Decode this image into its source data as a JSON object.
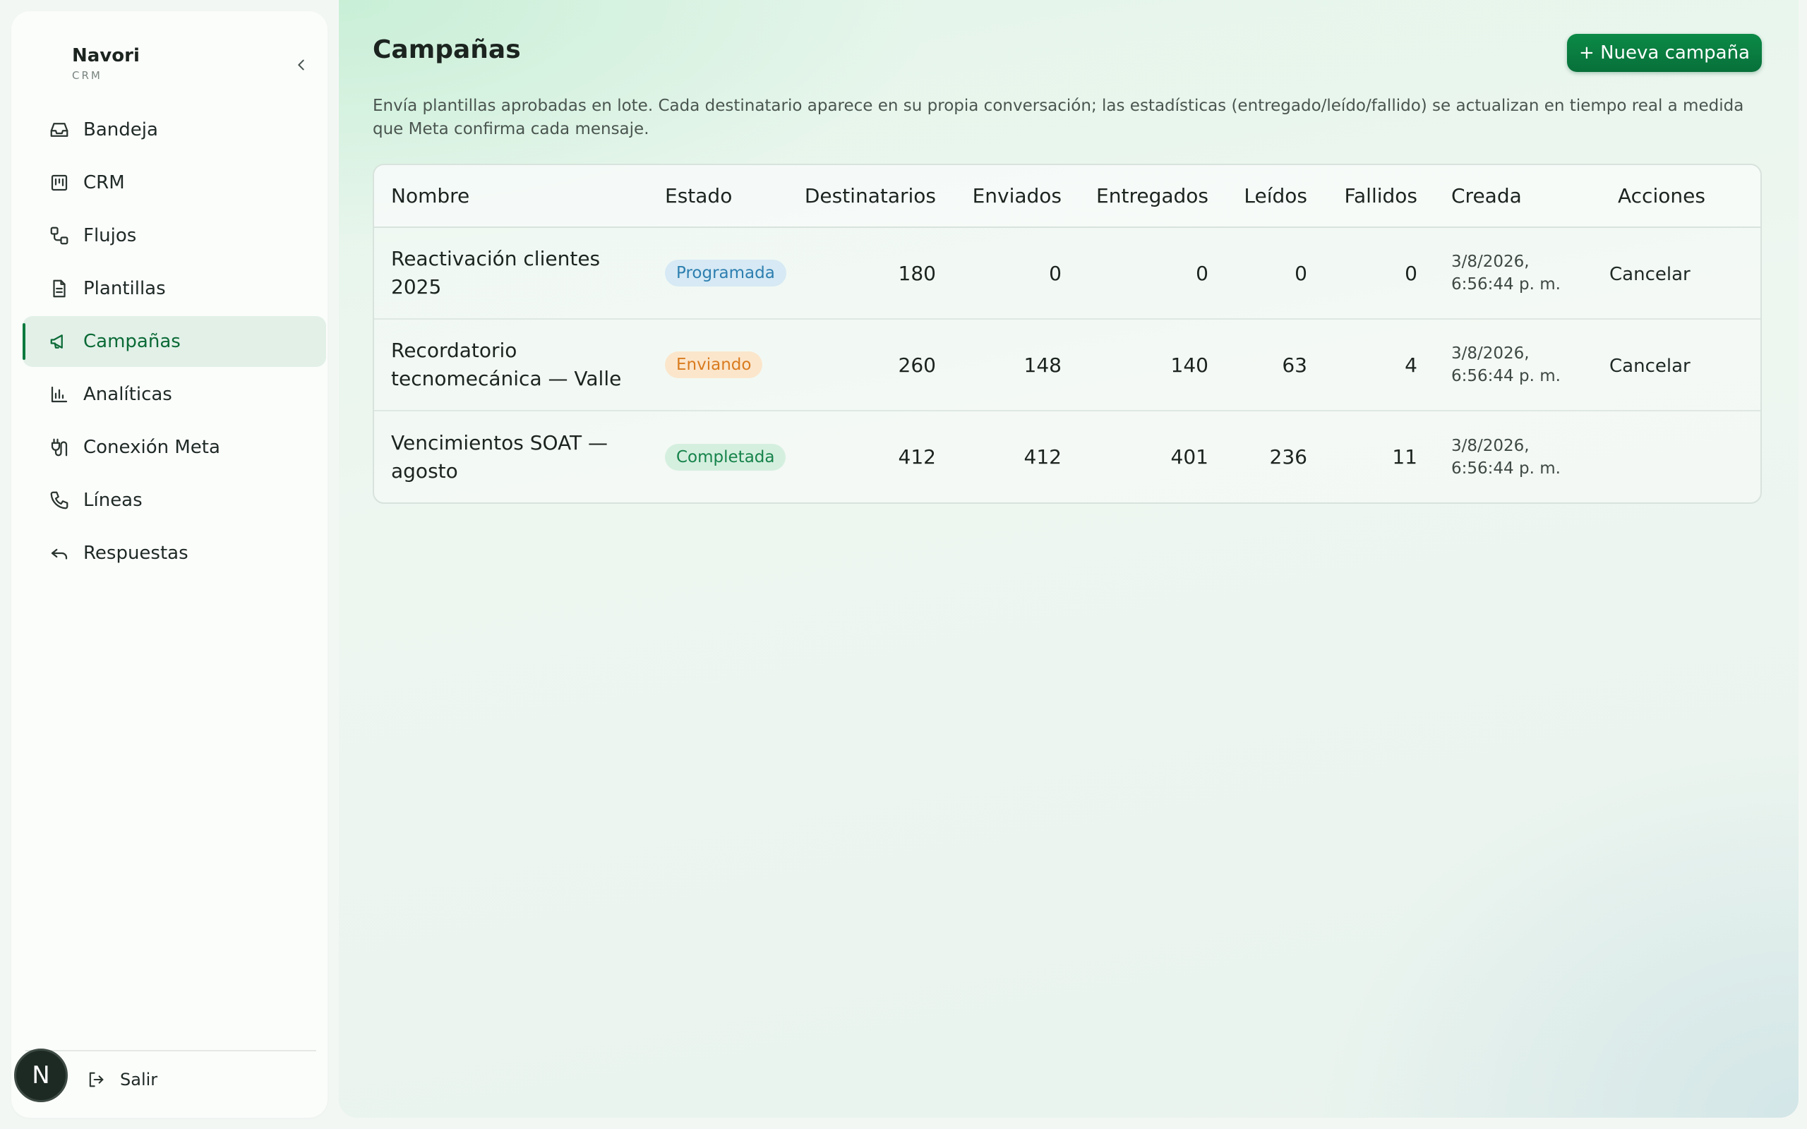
{
  "brand": {
    "name": "Navori",
    "sub": "CRM"
  },
  "sidebar": {
    "items": [
      {
        "label": "Bandeja",
        "icon": "inbox-icon"
      },
      {
        "label": "CRM",
        "icon": "kanban-icon"
      },
      {
        "label": "Flujos",
        "icon": "workflow-icon"
      },
      {
        "label": "Plantillas",
        "icon": "document-icon"
      },
      {
        "label": "Campañas",
        "icon": "megaphone-icon",
        "active": true
      },
      {
        "label": "Analíticas",
        "icon": "bar-chart-icon"
      },
      {
        "label": "Conexión Meta",
        "icon": "plug-icon"
      },
      {
        "label": "Líneas",
        "icon": "phone-icon"
      },
      {
        "label": "Respuestas",
        "icon": "reply-icon"
      }
    ],
    "avatar_letter": "N",
    "logout_label": "Salir"
  },
  "main": {
    "title": "Campañas",
    "new_button": "+ Nueva campaña",
    "description": "Envía plantillas aprobadas en lote. Cada destinatario aparece en su propia conversación; las estadísticas (entregado/leído/fallido) se actualizan en tiempo real a medida que Meta confirma cada mensaje."
  },
  "table": {
    "headers": {
      "nombre": "Nombre",
      "estado": "Estado",
      "destinatarios": "Destinatarios",
      "enviados": "Enviados",
      "entregados": "Entregados",
      "leidos": "Leídos",
      "fallidos": "Fallidos",
      "creada": "Creada",
      "acciones": "Acciones"
    },
    "rows": [
      {
        "nombre": "Reactivación clientes 2025",
        "estado": "Programada",
        "estado_color": "#2d7fb0",
        "destinatarios": "180",
        "enviados": "0",
        "entregados": "0",
        "leidos": "0",
        "fallidos": "0",
        "creada_fecha": "3/8/2026,",
        "creada_hora": "6:56:44 p. m.",
        "accion": "Cancelar"
      },
      {
        "nombre": "Recordatorio tecnomecánica — Valle",
        "estado": "Enviando",
        "estado_color": "#d97b1f",
        "destinatarios": "260",
        "enviados": "148",
        "entregados": "140",
        "leidos": "63",
        "fallidos": "4",
        "creada_fecha": "3/8/2026,",
        "creada_hora": "6:56:44 p. m.",
        "accion": "Cancelar"
      },
      {
        "nombre": "Vencimientos SOAT — agosto",
        "estado": "Completada",
        "estado_color": "#16834a",
        "destinatarios": "412",
        "enviados": "412",
        "entregados": "401",
        "leidos": "236",
        "fallidos": "11",
        "creada_fecha": "3/8/2026,",
        "creada_hora": "6:56:44 p. m.",
        "accion": ""
      }
    ]
  },
  "colors": {
    "accent": "#0b7a3e",
    "active_bg": "#e2f0e8"
  }
}
